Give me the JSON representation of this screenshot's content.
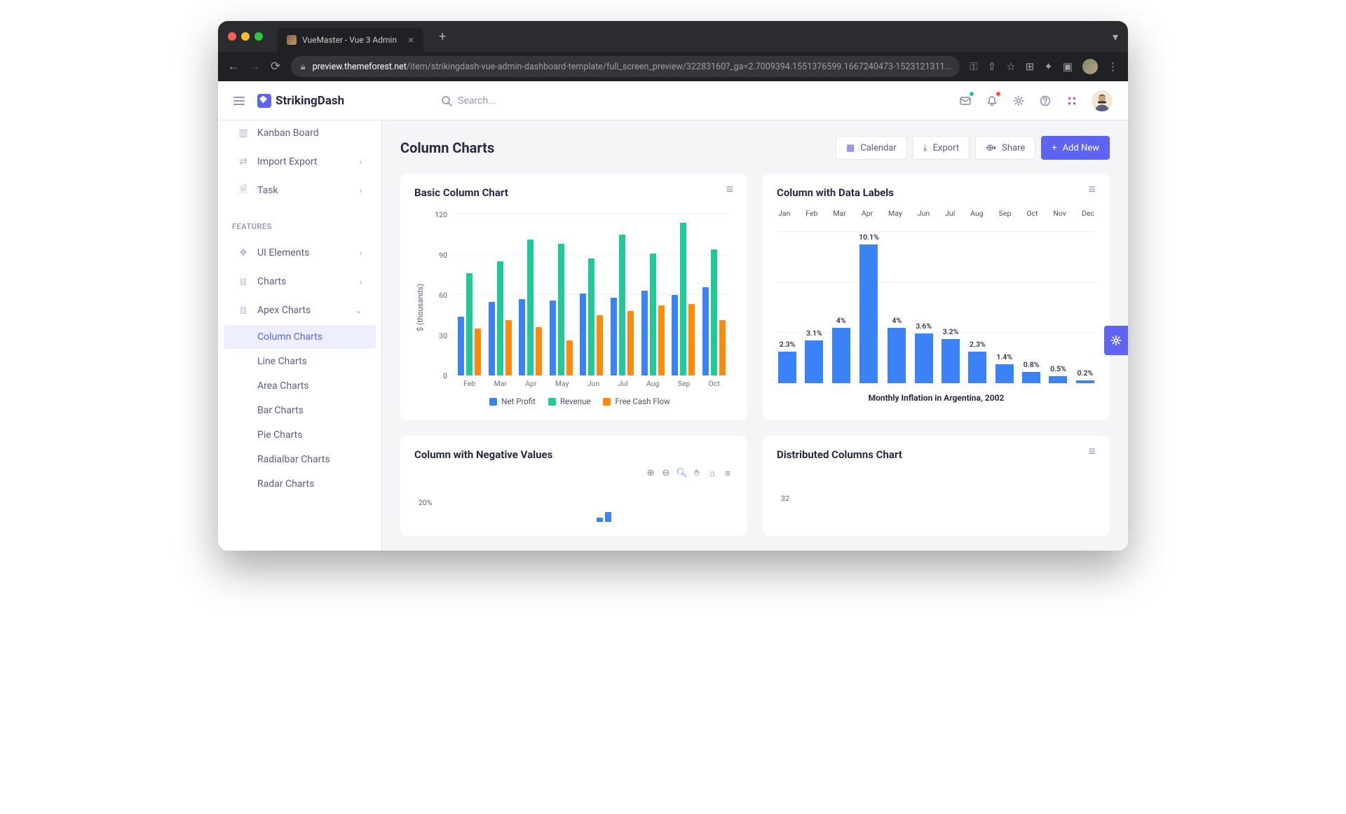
{
  "browser": {
    "tab_title": "VueMaster - Vue 3 Admin",
    "host": "preview.themeforest.net",
    "path": "/item/strikingdash-vue-admin-dashboard-template/full_screen_preview/32283160?_ga=2.7009394.1551376599.1667240473-1523121311..."
  },
  "brand": "StrikingDash",
  "search": {
    "placeholder": "Search..."
  },
  "sidebar": {
    "items": [
      {
        "label": "Kanban Board"
      },
      {
        "label": "Import Export"
      },
      {
        "label": "Task"
      }
    ],
    "section": "FEATURES",
    "features": [
      {
        "label": "UI Elements"
      },
      {
        "label": "Charts"
      },
      {
        "label": "Apex Charts"
      }
    ],
    "subs": [
      {
        "label": "Column Charts",
        "active": true
      },
      {
        "label": "Line Charts"
      },
      {
        "label": "Area Charts"
      },
      {
        "label": "Bar Charts"
      },
      {
        "label": "Pie Charts"
      },
      {
        "label": "Radialbar Charts"
      },
      {
        "label": "Radar Charts"
      }
    ]
  },
  "page": {
    "title": "Column Charts",
    "actions": {
      "calendar": "Calendar",
      "export": "Export",
      "share": "Share",
      "add": "Add New"
    }
  },
  "cards": {
    "c1": "Basic Column Chart",
    "c2": "Column with Data Labels",
    "c3": "Column with Negative Values",
    "c4": "Distributed Columns Chart"
  },
  "chart_data": [
    {
      "id": "basic-column",
      "type": "bar",
      "title": "Basic Column Chart",
      "ylabel": "$ (thousands)",
      "ymax": 120,
      "ticks": [
        0,
        30,
        60,
        90,
        120
      ],
      "categories": [
        "Feb",
        "Mar",
        "Apr",
        "May",
        "Jun",
        "Jul",
        "Aug",
        "Sep",
        "Oct"
      ],
      "series": [
        {
          "name": "Net Profit",
          "color": "#3B82F6",
          "values": [
            44,
            55,
            57,
            56,
            61,
            58,
            63,
            60,
            66
          ]
        },
        {
          "name": "Revenue",
          "color": "#20C997",
          "values": [
            76,
            85,
            101,
            98,
            87,
            105,
            91,
            114,
            94
          ]
        },
        {
          "name": "Free Cash Flow",
          "color": "#FA8B0C",
          "values": [
            35,
            41,
            36,
            26,
            45,
            48,
            52,
            53,
            41
          ]
        }
      ]
    },
    {
      "id": "data-labels",
      "type": "bar",
      "title": "Column with Data Labels",
      "subtitle": "Monthly Inflation in Argentina, 2002",
      "ymax": 11,
      "categories": [
        "Jan",
        "Feb",
        "Mar",
        "Apr",
        "May",
        "Jun",
        "Jul",
        "Aug",
        "Sep",
        "Oct",
        "Nov",
        "Dec"
      ],
      "labels": [
        "2.3%",
        "3.1%",
        "4%",
        "10.1%",
        "4%",
        "3.6%",
        "3.2%",
        "2.3%",
        "1.4%",
        "0.8%",
        "0.5%",
        "0.2%"
      ],
      "values": [
        2.3,
        3.1,
        4.0,
        10.1,
        4.0,
        3.6,
        3.2,
        2.3,
        1.4,
        0.8,
        0.5,
        0.2
      ],
      "color": "#3B82F6"
    },
    {
      "id": "negative-values",
      "type": "bar",
      "title": "Column with Negative Values",
      "ytick": "20%",
      "preview_values": [
        6,
        14
      ]
    },
    {
      "id": "distributed",
      "type": "bar",
      "title": "Distributed Columns Chart",
      "ytick": "32"
    }
  ]
}
